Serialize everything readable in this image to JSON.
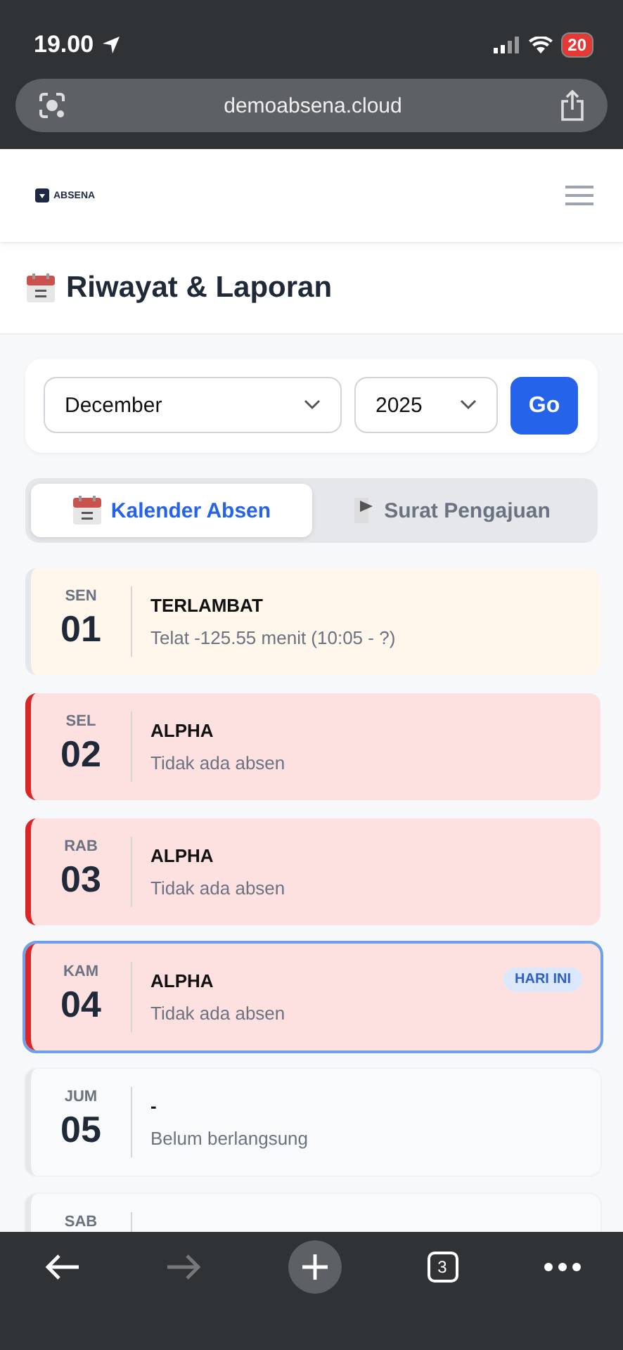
{
  "status_bar": {
    "time": "19.00",
    "battery": "20"
  },
  "browser": {
    "url": "demoabsena.cloud",
    "tab_count": "3",
    "forward_disabled": true
  },
  "header": {
    "logo_text": "ABSENA"
  },
  "page_title": "Riwayat & Laporan",
  "filter": {
    "month": "December",
    "year": "2025",
    "button": "Go"
  },
  "tabs": [
    {
      "label": "Kalender Absen",
      "selected": true
    },
    {
      "label": "Surat Pengajuan",
      "selected": false
    }
  ],
  "days": [
    {
      "day": "SEN",
      "date": "01",
      "status": "TERLAMBAT",
      "note": "Telat -125.55 menit (10:05 - ?)",
      "kind": "late",
      "today": false
    },
    {
      "day": "SEL",
      "date": "02",
      "status": "ALPHA",
      "note": "Tidak ada absen",
      "kind": "alpha",
      "today": false
    },
    {
      "day": "RAB",
      "date": "03",
      "status": "ALPHA",
      "note": "Tidak ada absen",
      "kind": "alpha",
      "today": false
    },
    {
      "day": "KAM",
      "date": "04",
      "status": "ALPHA",
      "note": "Tidak ada absen",
      "kind": "alpha",
      "today": true,
      "badge": "HARI INI"
    },
    {
      "day": "JUM",
      "date": "05",
      "status": "-",
      "note": "Belum berlangsung",
      "kind": "pending",
      "today": false
    },
    {
      "day": "SAB",
      "kind": "pending",
      "today": false
    }
  ]
}
